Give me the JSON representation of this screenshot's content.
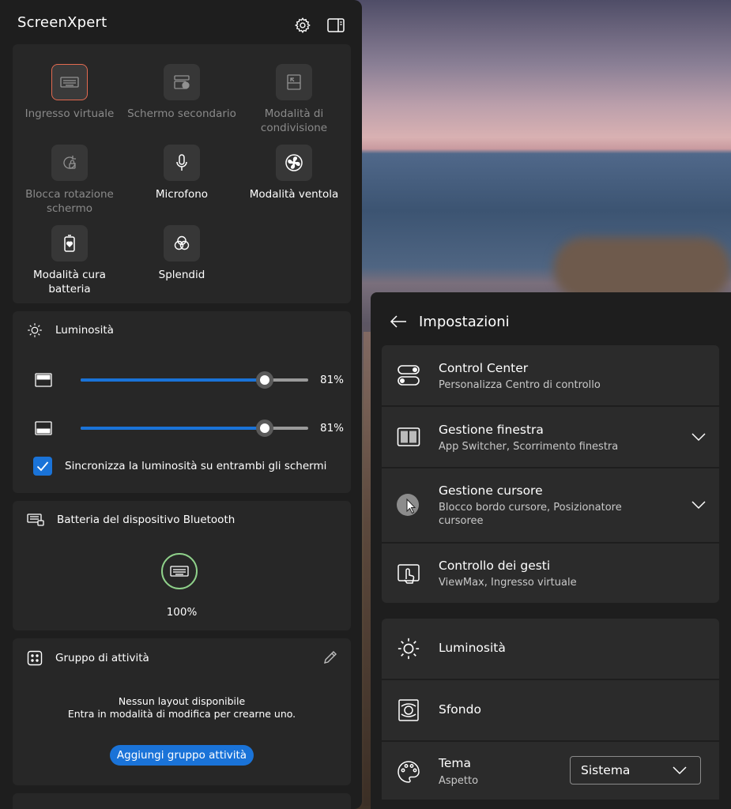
{
  "app": {
    "title": "ScreenXpert"
  },
  "header_icons": [
    "gear-icon",
    "sidebar-toggle-icon"
  ],
  "quick_toggles": [
    {
      "label": "Ingresso virtuale",
      "icon": "virtual-keyboard-icon",
      "state": "active-dim"
    },
    {
      "label": "Schermo secondario",
      "icon": "secondary-screen-icon",
      "state": "disabled"
    },
    {
      "label": "Modalità di condivisione",
      "icon": "share-mode-icon",
      "state": "disabled"
    },
    {
      "label": "Blocca rotazione schermo",
      "icon": "rotation-lock-icon",
      "state": "disabled"
    },
    {
      "label": "Microfono",
      "icon": "microphone-icon",
      "state": "enabled"
    },
    {
      "label": "Modalità ventola",
      "icon": "fan-icon",
      "state": "enabled"
    },
    {
      "label": "Modalità cura batteria",
      "icon": "battery-care-icon",
      "state": "enabled"
    },
    {
      "label": "Splendid",
      "icon": "splendid-icon",
      "state": "enabled"
    }
  ],
  "brightness": {
    "title": "Luminosità",
    "sliders": [
      {
        "value": 81,
        "label": "81%"
      },
      {
        "value": 81,
        "label": "81%"
      }
    ],
    "sync_label": "Sincronizza la luminosità su entrambi gli schermi",
    "sync_checked": true
  },
  "bluetooth": {
    "title": "Batteria del dispositivo Bluetooth",
    "level": 100,
    "label": "100%"
  },
  "task_group": {
    "title": "Gruppo di attività",
    "empty_title": "Nessun layout disponibile",
    "empty_hint": "Entra in modalità di modifica per crearne uno.",
    "add_button": "Aggiungi gruppo attività"
  },
  "settings": {
    "title": "Impostazioni",
    "rows": [
      {
        "title": "Control Center",
        "subtitle": "Personalizza Centro di controllo",
        "icon": "toggle-switches-icon"
      },
      {
        "title": "Gestione finestra",
        "subtitle": "App Switcher, Scorrimento finestra",
        "icon": "window-split-icon"
      },
      {
        "title": "Gestione cursore",
        "subtitle": "Blocco bordo cursore, Posizionatore cursoree",
        "icon": "cursor-icon"
      },
      {
        "title": "Controllo dei gesti",
        "subtitle": "ViewMax, Ingresso virtuale",
        "icon": "touch-gesture-icon"
      },
      {
        "title": "Luminosità",
        "icon": "brightness-icon"
      },
      {
        "title": "Sfondo",
        "icon": "wallpaper-icon"
      },
      {
        "title": "Tema",
        "subtitle": "Aspetto",
        "icon": "palette-icon",
        "dropdown_value": "Sistema"
      }
    ]
  },
  "colors": {
    "accent": "#1a73d8",
    "active_outline": "#e36a50",
    "battery_ring": "#8fd18a"
  }
}
